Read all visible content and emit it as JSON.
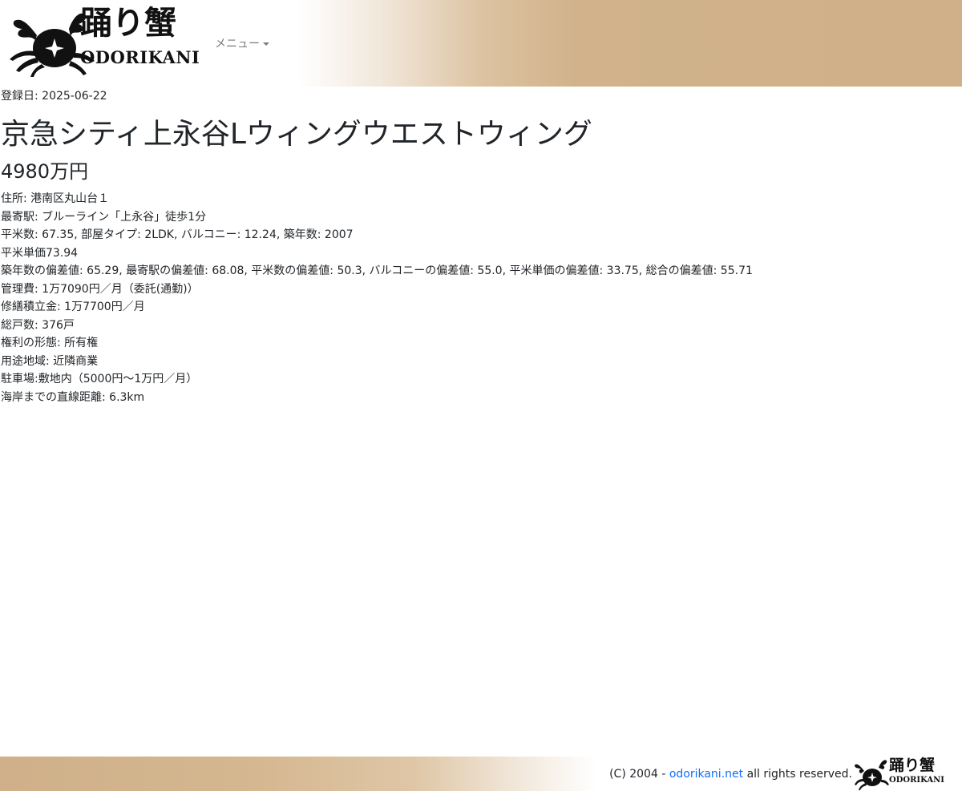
{
  "header": {
    "logo": {
      "jp": "踊り蟹",
      "en": "ODORIKANI"
    },
    "menu_label": "メニュー"
  },
  "listing": {
    "registered": "登録日: 2025-06-22",
    "title": "京急シティ上永谷Lウィングウエストウィング",
    "price": "4980万円",
    "details": [
      "住所: 港南区丸山台１",
      "最寄駅: ブルーライン「上永谷」徒歩1分",
      "平米数: 67.35, 部屋タイプ: 2LDK, バルコニー: 12.24, 築年数: 2007",
      "平米単価73.94",
      "築年数の偏差値: 65.29, 最寄駅の偏差値: 68.08, 平米数の偏差値: 50.3, バルコニーの偏差値: 55.0, 平米単価の偏差値: 33.75, 総合の偏差値: 55.71",
      "管理費: 1万7090円／月（委託(通勤)）",
      "修繕積立金: 1万7700円／月",
      "総戸数: 376戸",
      "権利の形態: 所有権",
      "用途地域: 近隣商業",
      "駐車場:敷地内（5000円～1万円／月）",
      "海岸までの直線距離: 6.3km"
    ]
  },
  "footer": {
    "copyright_prefix": "(C) 2004 -",
    "link_text": "odorikani.net",
    "copyright_suffix": "all rights reserved."
  },
  "colors": {
    "header_gold": "#cfb089",
    "link_blue": "#0d6efd",
    "text": "#212529"
  }
}
